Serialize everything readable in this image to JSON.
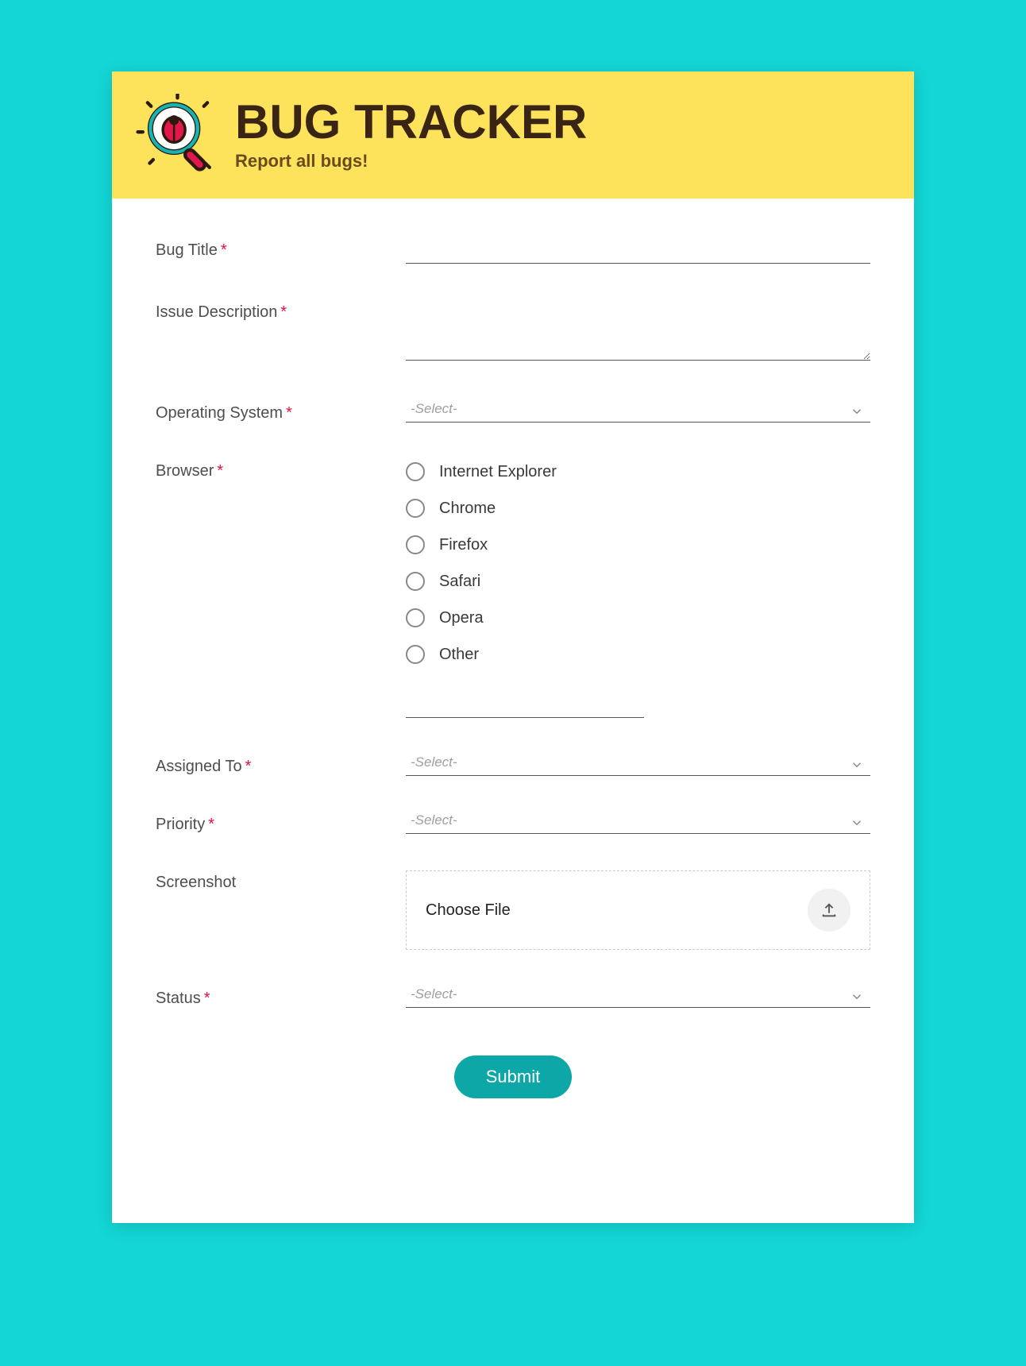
{
  "header": {
    "title": "BUG TRACKER",
    "subtitle": "Report all bugs!"
  },
  "form": {
    "bug_title": {
      "label": "Bug Title",
      "required": true
    },
    "issue_description": {
      "label": "Issue Description",
      "required": true
    },
    "operating_system": {
      "label": "Operating System",
      "required": true,
      "placeholder": "-Select-"
    },
    "browser": {
      "label": "Browser",
      "required": true,
      "options": [
        "Internet Explorer",
        "Chrome",
        "Firefox",
        "Safari",
        "Opera",
        "Other"
      ]
    },
    "assigned_to": {
      "label": "Assigned To",
      "required": true,
      "placeholder": "-Select-"
    },
    "priority": {
      "label": "Priority",
      "required": true,
      "placeholder": "-Select-"
    },
    "screenshot": {
      "label": "Screenshot",
      "required": false,
      "choose_label": "Choose File"
    },
    "status": {
      "label": "Status",
      "required": true,
      "placeholder": "-Select-"
    },
    "submit_label": "Submit"
  }
}
